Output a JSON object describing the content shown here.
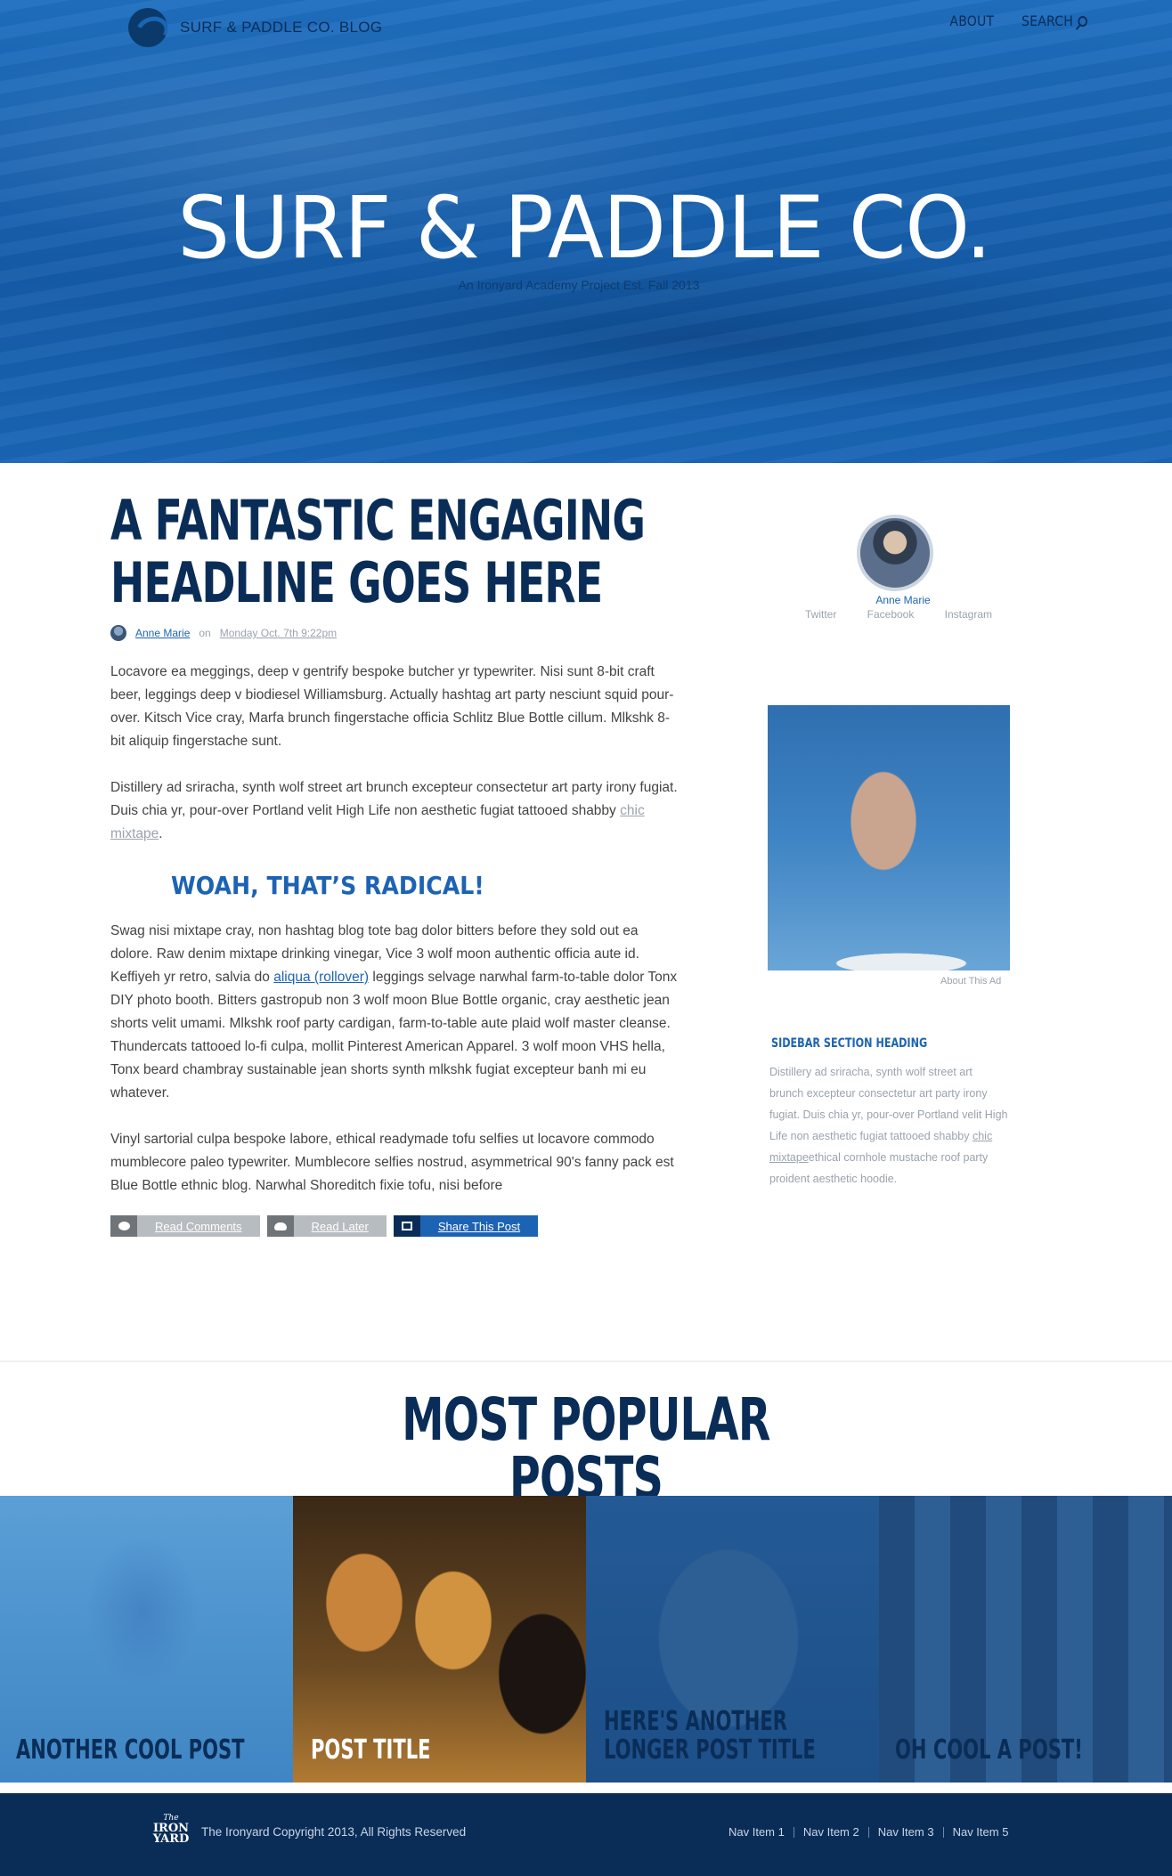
{
  "header": {
    "brand_name": "SURF & PADDLE CO. BLOG",
    "nav": [
      "ABOUT",
      "SEARCH"
    ],
    "hero_title": "SURF & PADDLE CO.",
    "hero_subtitle": "An Ironyard Academy Project Est. Fall 2013"
  },
  "article": {
    "headline": "A FANTASTIC ENGAGING HEADLINE GOES HERE",
    "author": "Anne Marie",
    "on_label": "on",
    "date": "Monday Oct. 7th 9:22pm",
    "paragraph1": "Locavore ea meggings, deep v gentrify bespoke butcher yr typewriter. Nisi sunt 8-bit craft beer, leggings deep v biodiesel Williamsburg. Actually hashtag art party nesciunt squid pour-over. Kitsch Vice cray, Marfa brunch fingerstache officia Schlitz Blue Bottle cillum. Mlkshk 8-bit aliquip fingerstache sunt.",
    "paragraph2": "Distillery ad sriracha, synth wolf street art brunch excepteur consectetur art party irony fugiat. Duis chia yr, pour-over Portland velit High Life non aesthetic fugiat tattooed shabby",
    "paragraph2_link": "chic mixtape",
    "subheading": "WOAH, THAT’S RADICAL!",
    "paragraph3_a": "Swag nisi mixtape cray, non hashtag blog tote bag dolor bitters before they sold out ea dolore. Raw denim mixtape drinking vinegar, Vice 3 wolf moon authentic officia aute id. Keffiyeh yr retro, salvia do",
    "paragraph3_link": "aliqua (rollover)",
    "paragraph3_b": "leggings selvage narwhal farm-to-table dolor Tonx DIY photo booth. Bitters gastropub non 3 wolf moon Blue Bottle organic, cray aesthetic jean shorts velit umami. Mlkshk roof party cardigan, farm-to-table aute plaid wolf master cleanse. Thundercats tattooed lo-fi culpa, mollit Pinterest American Apparel. 3 wolf moon VHS hella, Tonx beard chambray sustainable jean shorts synth mlkshk fugiat excepteur banh mi eu whatever.",
    "paragraph4": "Vinyl sartorial culpa bespoke labore, ethical readymade tofu selfies ut locavore commodo mumblecore paleo typewriter. Mumblecore selfies nostrud, asymmetrical 90's fanny pack est Blue Bottle ethnic blog. Narwhal Shoreditch fixie tofu, nisi before",
    "actions": [
      "Read Comments",
      "Read Later",
      "Share This Post"
    ]
  },
  "sidebar": {
    "name": "Anne Marie",
    "social": [
      "Twitter",
      "Facebook",
      "Instagram"
    ],
    "ad_label": "About This Ad",
    "section_heading": "SIDEBAR SECTION HEADING",
    "section_text_a": "Distillery ad sriracha, synth wolf street art brunch excepteur consectetur art party irony fugiat. Duis chia yr, pour-over Portland velit High Life non aesthetic fugiat tattooed shabby",
    "section_link": "chic mixtape",
    "section_text_b": "ethical cornhole mustache roof party proident aesthetic hoodie."
  },
  "popular": {
    "title": "MOST POPULAR POSTS",
    "posts": [
      {
        "title_line1": "ANOTHER COOL POST",
        "title_line2": ""
      },
      {
        "title_line1": "POST TITLE",
        "title_line2": ""
      },
      {
        "title_line1": "HERE'S ANOTHER",
        "title_line2": "LONGER POST TITLE"
      },
      {
        "title_line1": "OH COOL A POST!",
        "title_line2": ""
      }
    ]
  },
  "footer": {
    "logo_line1": "The",
    "logo_line2": "IRON",
    "logo_line3": "YARD",
    "copyright": "The Ironyard Copyright 2013, All Rights Reserved",
    "nav": [
      "Nav Item 1",
      "Nav Item 2",
      "Nav Item 3",
      "Nav Item 5"
    ]
  },
  "colors": {
    "brand_navy": "#0a2d57",
    "accent_blue": "#1d63b4",
    "muted_gray": "#9aa3ad"
  }
}
